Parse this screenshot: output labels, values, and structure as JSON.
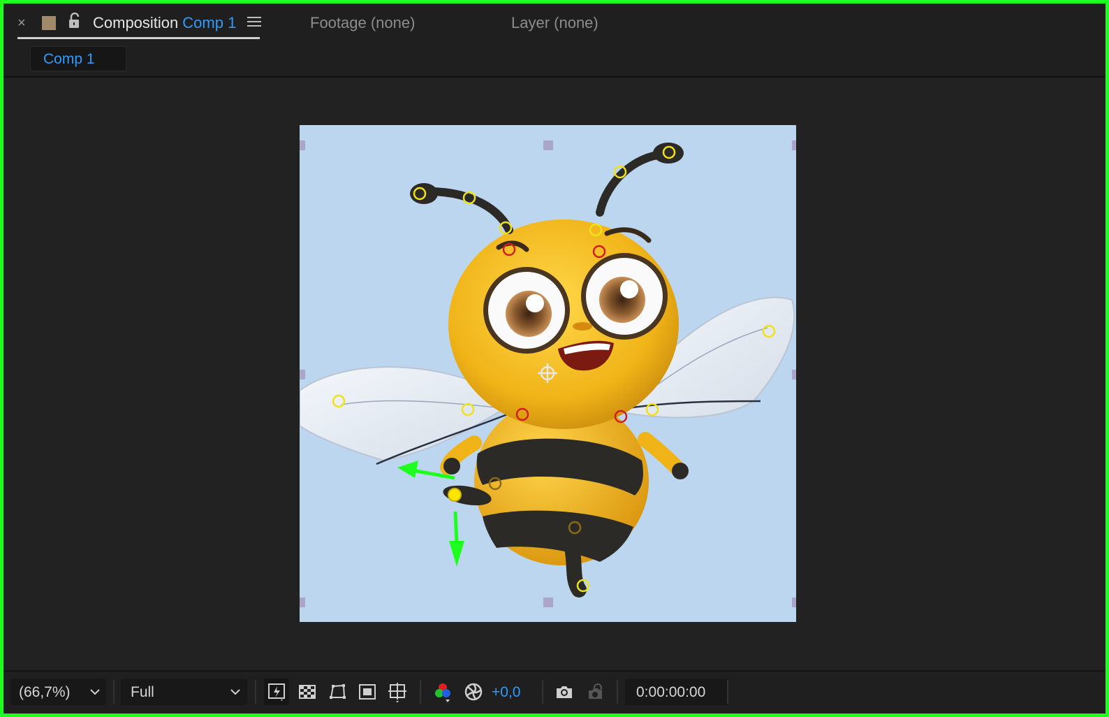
{
  "panel": {
    "tabs": {
      "close": "×",
      "composition_prefix": "Composition",
      "composition_name": "Comp 1",
      "footage": "Footage (none)",
      "layer": "Layer (none)"
    },
    "breadcrumb": "Comp 1"
  },
  "viewer": {
    "background_color": "#bdd6f0",
    "layer_handles": "square transform handles",
    "puppet_pins_color": "#f0e21a",
    "puppet_pins_selected": "#ffe600",
    "puppet_pins_bound": "#d11f1f",
    "motion_arrows_color": "#1fff1f",
    "anchor_point_icon": "anchor-crosshair-icon"
  },
  "toolbar": {
    "zoom": "(66,7%)",
    "resolution": "Full",
    "exposure": "+0,0",
    "timecode": "0:00:00:00",
    "icons": [
      "fast-preview-icon",
      "transparency-grid-icon",
      "mask-path-icon",
      "region-of-interest-icon",
      "grid-guides-icon",
      "channel-rgb-icon",
      "exposure-reset-icon",
      "snapshot-camera-icon",
      "show-snapshot-icon"
    ]
  },
  "colors": {
    "accent": "#2d9bff",
    "frame_border": "#1fff1f"
  }
}
